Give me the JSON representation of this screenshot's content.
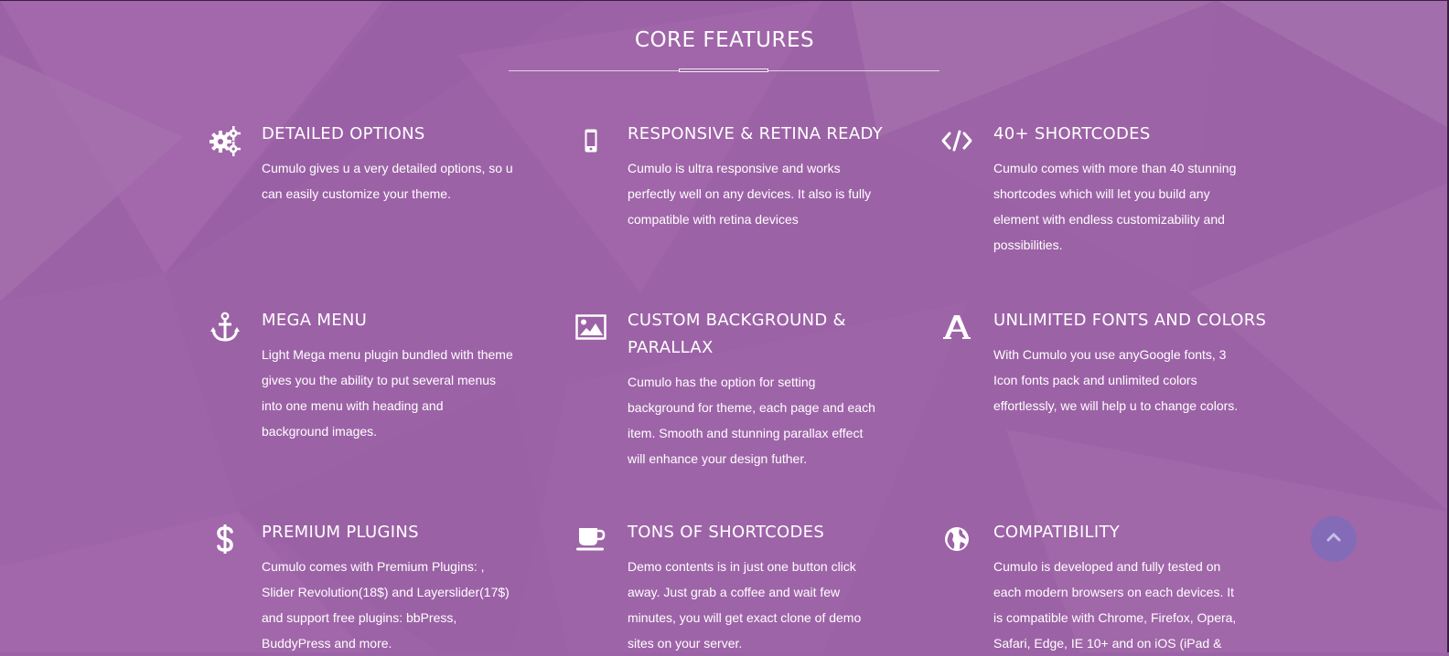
{
  "section": {
    "title": "CORE FEATURES"
  },
  "colors": {
    "background": "#9c62a6",
    "text": "#ffffff",
    "scroll_button": "#786ebe"
  },
  "features": [
    {
      "icon": "gears-icon",
      "title": "DETAILED OPTIONS",
      "text": "Cumulo gives u a very detailed options, so u can easily customize your theme."
    },
    {
      "icon": "mobile-phone-icon",
      "title": "RESPONSIVE & RETINA READY",
      "text": "Cumulo is ultra responsive and works perfectly well on any devices. It also is fully compatible with retina devices"
    },
    {
      "icon": "code-icon",
      "title": "40+ SHORTCODES",
      "text": "Cumulo comes with more than 40 stunning shortcodes which will let you build any element with endless customizability and possibilities."
    },
    {
      "icon": "anchor-icon",
      "title": "MEGA MENU",
      "text": "Light Mega menu plugin bundled with theme gives you the ability to put several menus into one menu with heading and background images."
    },
    {
      "icon": "picture-icon",
      "title": "CUSTOM BACKGROUND & PARALLAX",
      "text": "Cumulo has the option for setting background for theme, each page and each item. Smooth and stunning parallax effect will enhance your design futher."
    },
    {
      "icon": "font-icon",
      "title": "UNLIMITED FONTS AND COLORS",
      "text": "With Cumulo you use anyGoogle fonts, 3 Icon fonts pack and unlimited colors effortlessly, we will help u to change colors."
    },
    {
      "icon": "dollar-icon",
      "title": "PREMIUM PLUGINS",
      "text": "Cumulo comes with Premium Plugins: , Slider Revolution(18$) and Layerslider(17$) and support free plugins: bbPress, BuddyPress and more."
    },
    {
      "icon": "coffee-icon",
      "title": "TONS OF SHORTCODES",
      "text": "Demo contents is in just one button click away. Just grab a coffee and wait few minutes, you will get exact clone of demo sites on your server."
    },
    {
      "icon": "globe-icon",
      "title": "COMPATIBILITY",
      "text": "Cumulo is developed and fully tested on each modern browsers on each devices. It is compatible with Chrome, Firefox, Opera, Safari, Edge, IE 10+ and on iOS (iPad &"
    }
  ],
  "scroll_top": {
    "icon": "chevron-up-icon"
  }
}
